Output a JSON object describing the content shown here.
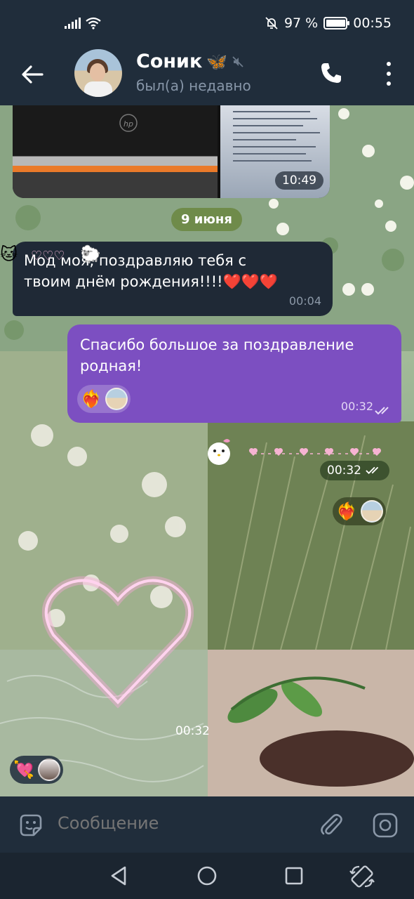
{
  "status_bar": {
    "battery": "97 %",
    "time": "00:55",
    "network": "4+",
    "battery_level": 0.97
  },
  "header": {
    "name": "Соник",
    "status": "был(а) недавно",
    "title_emoji": "🦋"
  },
  "messages": {
    "photo_time": "10:49",
    "date_divider": "9 июня",
    "incoming": {
      "line1": "Мод  моя, поздравляю тебя с",
      "line2": "твоим днём рождения!!!!❤️❤️❤️",
      "time": "00:04"
    },
    "outgoing": {
      "line1": "Спасибо большое за поздравление",
      "line2": "родная!",
      "time": "00:32",
      "reaction": "❤️‍🔥"
    },
    "sticker1": {
      "time": "00:32",
      "reaction": "❤️‍🔥"
    },
    "sticker2": {
      "time": "00:32",
      "reaction": "💘"
    }
  },
  "input": {
    "placeholder": "Сообщение"
  },
  "colors": {
    "header_bg": "#202d3b",
    "outgoing_bubble": "#7c4fc1",
    "incoming_bubble": "#1f2936",
    "date_pill": "#6f8b4a"
  }
}
